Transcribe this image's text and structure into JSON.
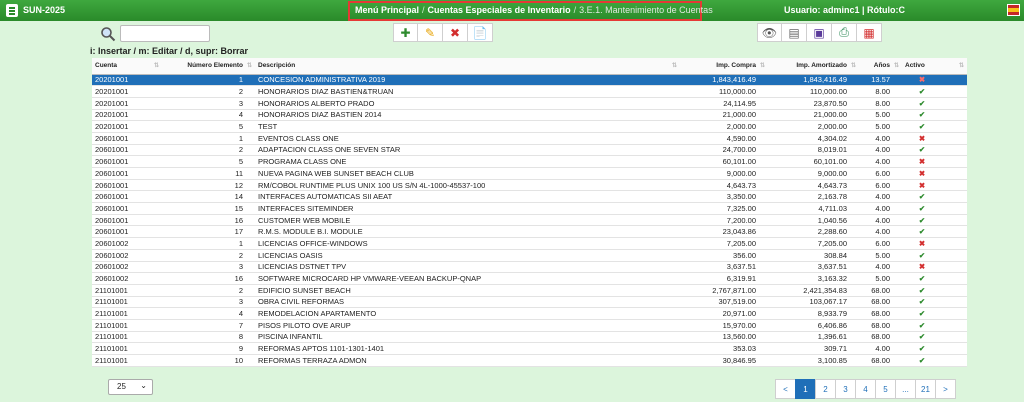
{
  "app": {
    "name": "SUN-2025"
  },
  "breadcrumb": {
    "items": [
      "Menú Principal",
      "Cuentas Especiales de Inventario",
      "3.E.1. Mantenimiento de Cuentas"
    ],
    "separator": "/"
  },
  "user": {
    "label": "Usuario: adminc1 | Rótulo:C"
  },
  "search": {
    "value": "",
    "placeholder": ""
  },
  "hint": "i: Insertar / m: Editar / d, supr: Borrar",
  "toolbar_left": [
    {
      "icon": "add-icon",
      "glyph": "✚",
      "color": "#2e8b2e"
    },
    {
      "icon": "edit-icon",
      "glyph": "✎",
      "color": "#e6a100"
    },
    {
      "icon": "delete-icon",
      "glyph": "✖",
      "color": "#d32f2f"
    },
    {
      "icon": "document-icon",
      "glyph": "📄",
      "color": "#888"
    }
  ],
  "toolbar_right": [
    {
      "icon": "view-icon",
      "glyph": "👁",
      "color": "#555"
    },
    {
      "icon": "copy-icon",
      "glyph": "▤",
      "color": "#666"
    },
    {
      "icon": "print-icon",
      "glyph": "▣",
      "color": "#5a3a9a"
    },
    {
      "icon": "printer-icon",
      "glyph": "⎙",
      "color": "#2e8b57"
    },
    {
      "icon": "pdf-icon",
      "glyph": "▦",
      "color": "#d32f2f"
    }
  ],
  "table": {
    "columns": [
      "Cuenta",
      "Número Elemento",
      "Descripción",
      "Imp. Compra",
      "Imp. Amortizado",
      "Años",
      "Activo"
    ],
    "rows": [
      [
        "20201001",
        "1",
        "CONCESION ADMINISTRATIVA 2019",
        "1,843,416.49",
        "1,843,416.49",
        "13.57",
        "no"
      ],
      [
        "20201001",
        "2",
        "HONORARIOS DIAZ BASTIEN&TRUAN",
        "110,000.00",
        "110,000.00",
        "8.00",
        "ok"
      ],
      [
        "20201001",
        "3",
        "HONORARIOS ALBERTO PRADO",
        "24,114.95",
        "23,870.50",
        "8.00",
        "ok"
      ],
      [
        "20201001",
        "4",
        "HONORARIOS DIAZ BASTIEN 2014",
        "21,000.00",
        "21,000.00",
        "5.00",
        "ok"
      ],
      [
        "20201001",
        "5",
        "TEST",
        "2,000.00",
        "2,000.00",
        "5.00",
        "ok"
      ],
      [
        "20601001",
        "1",
        "EVENTOS CLASS ONE",
        "4,590.00",
        "4,304.02",
        "4.00",
        "no"
      ],
      [
        "20601001",
        "2",
        "ADAPTACION CLASS ONE SEVEN STAR",
        "24,700.00",
        "8,019.01",
        "4.00",
        "ok"
      ],
      [
        "20601001",
        "5",
        "PROGRAMA CLASS ONE",
        "60,101.00",
        "60,101.00",
        "4.00",
        "no"
      ],
      [
        "20601001",
        "11",
        "NUEVA PAGINA WEB SUNSET BEACH CLUB",
        "9,000.00",
        "9,000.00",
        "6.00",
        "no"
      ],
      [
        "20601001",
        "12",
        "RM/COBOL RUNTIME PLUS UNIX 100 US S/N 4L-1000-45537-100",
        "4,643.73",
        "4,643.73",
        "6.00",
        "no"
      ],
      [
        "20601001",
        "14",
        "INTERFACES AUTOMATICAS SII AEAT",
        "3,350.00",
        "2,163.78",
        "4.00",
        "ok"
      ],
      [
        "20601001",
        "15",
        "INTERFACES SITEMINDER",
        "7,325.00",
        "4,711.03",
        "4.00",
        "ok"
      ],
      [
        "20601001",
        "16",
        "CUSTOMER WEB MOBILE",
        "7,200.00",
        "1,040.56",
        "4.00",
        "ok"
      ],
      [
        "20601001",
        "17",
        "R.M.S. MODULE B.I. MODULE",
        "23,043.86",
        "2,288.60",
        "4.00",
        "ok"
      ],
      [
        "20601002",
        "1",
        "LICENCIAS OFFICE-WINDOWS",
        "7,205.00",
        "7,205.00",
        "6.00",
        "no"
      ],
      [
        "20601002",
        "2",
        "LICENCIAS OASIS",
        "356.00",
        "308.84",
        "5.00",
        "ok"
      ],
      [
        "20601002",
        "3",
        "LICENCIAS DSTNET TPV",
        "3,637.51",
        "3,637.51",
        "4.00",
        "no"
      ],
      [
        "20601002",
        "16",
        "SOFTWARE MICROCARD HP VMWARE-VEEAN BACKUP-QNAP",
        "6,319.91",
        "3,163.32",
        "5.00",
        "ok"
      ],
      [
        "21101001",
        "2",
        "EDIFICIO SUNSET BEACH",
        "2,767,871.00",
        "2,421,354.83",
        "68.00",
        "ok"
      ],
      [
        "21101001",
        "3",
        "OBRA CIVIL REFORMAS",
        "307,519.00",
        "103,067.17",
        "68.00",
        "ok"
      ],
      [
        "21101001",
        "4",
        "REMODELACION APARTAMENTO",
        "20,971.00",
        "8,933.79",
        "68.00",
        "ok"
      ],
      [
        "21101001",
        "7",
        "PISOS PILOTO OVE ARUP",
        "15,970.00",
        "6,406.86",
        "68.00",
        "ok"
      ],
      [
        "21101001",
        "8",
        "PISCINA INFANTIL",
        "13,560.00",
        "1,396.61",
        "68.00",
        "ok"
      ],
      [
        "21101001",
        "9",
        "REFORMAS APTOS 1101-1301-1401",
        "353.03",
        "309.71",
        "4.00",
        "ok"
      ],
      [
        "21101001",
        "10",
        "REFORMAS TERRAZA ADMON",
        "30,846.95",
        "3,100.85",
        "68.00",
        "ok"
      ]
    ]
  },
  "page_size": {
    "value": "25"
  },
  "pagination": {
    "prev": "<",
    "pages": [
      "1",
      "2",
      "3",
      "4",
      "5",
      "...",
      "21"
    ],
    "next": ">",
    "current": "1"
  },
  "colors": {
    "accent": "#2a8a2a",
    "selected": "#1f6fb8",
    "background": "#dcf5dc"
  }
}
